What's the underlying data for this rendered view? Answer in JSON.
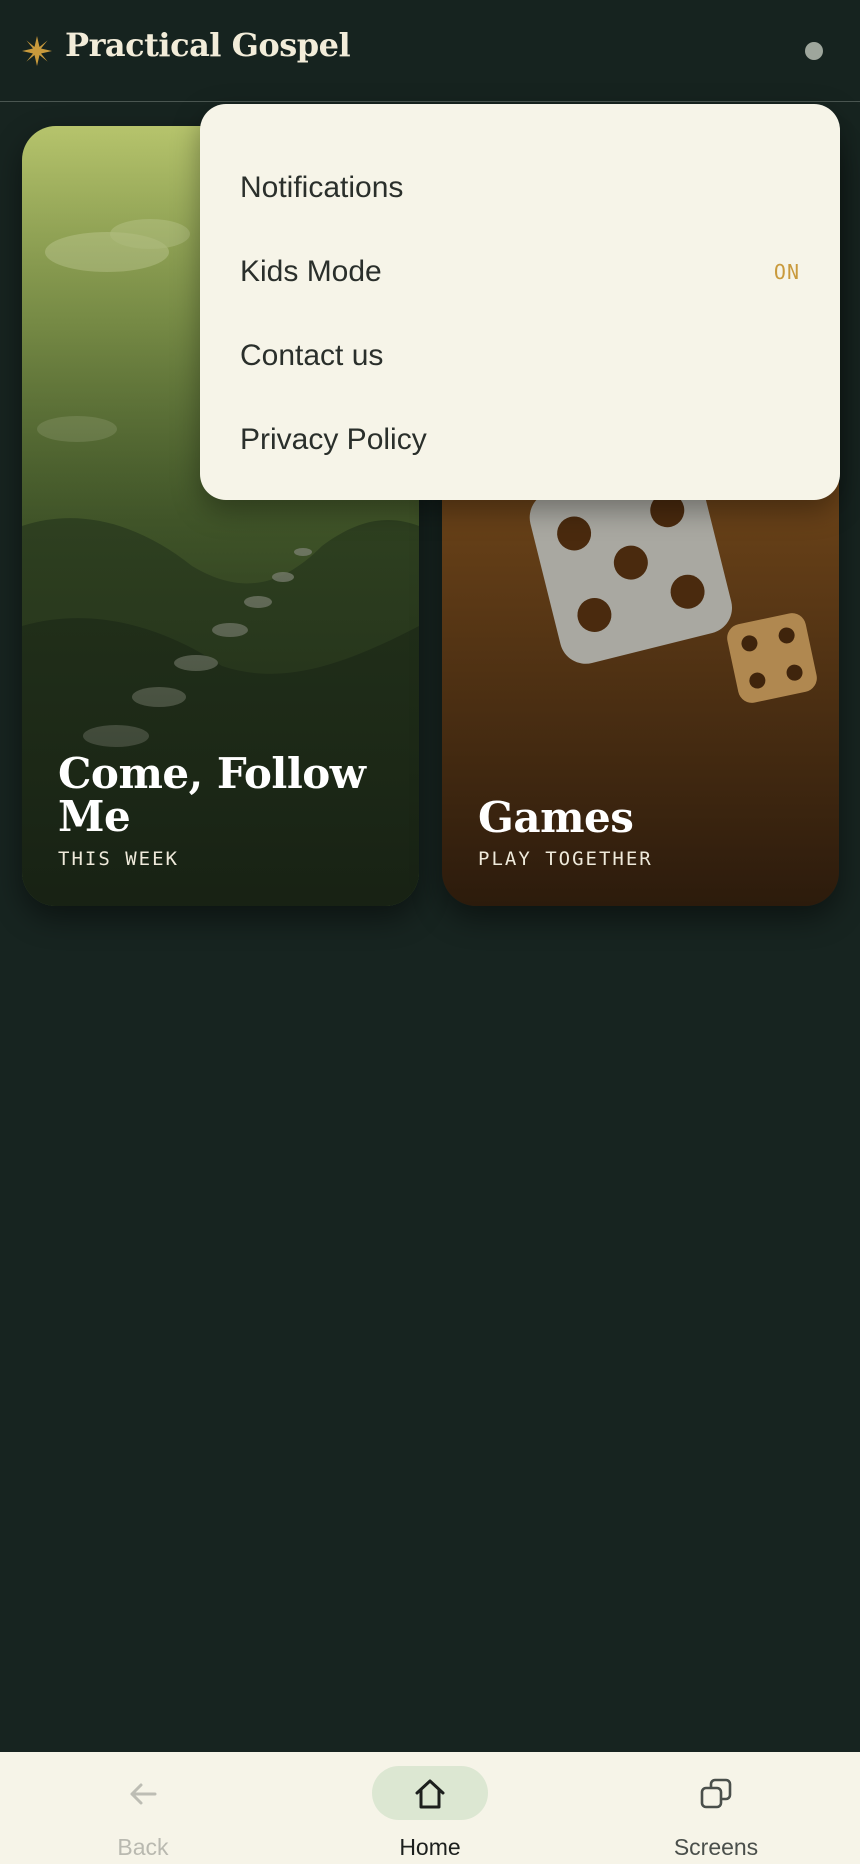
{
  "header": {
    "title": "Practical Gospel",
    "logo_icon": "sunburst-icon",
    "accent_color": "#c99a3c"
  },
  "cards": [
    {
      "title": "Come, Follow Me",
      "subtitle": "THIS WEEK",
      "art": "stepping-stones-path"
    },
    {
      "title": "Games",
      "subtitle": "PLAY TOGETHER",
      "art": "dice"
    }
  ],
  "menu": {
    "items": [
      {
        "label": "Notifications"
      },
      {
        "label": "Kids Mode",
        "state": "ON"
      },
      {
        "label": "Contact us"
      },
      {
        "label": "Privacy Policy"
      }
    ]
  },
  "bottom_nav": {
    "items": [
      {
        "label": "Back",
        "icon": "arrow-left-icon",
        "enabled": false
      },
      {
        "label": "Home",
        "icon": "home-icon",
        "active": true
      },
      {
        "label": "Screens",
        "icon": "screens-icon"
      }
    ]
  }
}
